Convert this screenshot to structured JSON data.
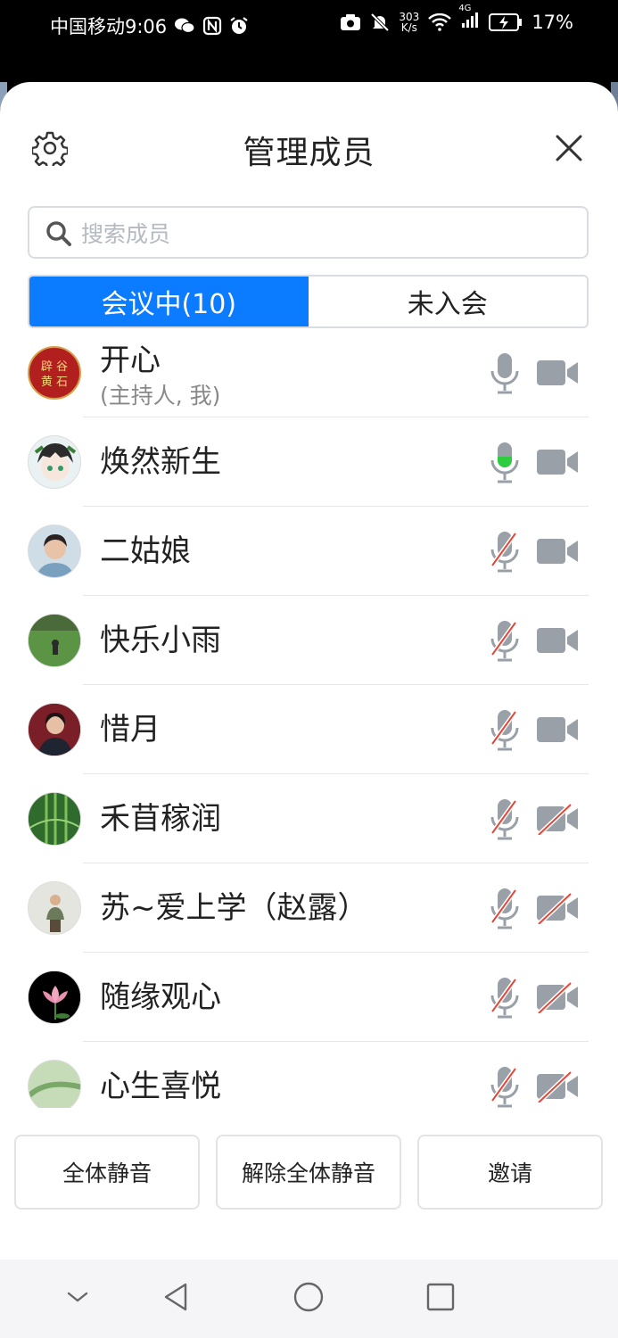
{
  "status_bar": {
    "carrier_time": "中国移动9:06",
    "net_speed_top": "303",
    "net_speed_bottom": "K/s",
    "signal_tag": "4G",
    "battery": "17%"
  },
  "panel": {
    "title": "管理成员",
    "search_placeholder": "搜索成员",
    "tabs": [
      {
        "label": "会议中(10)",
        "active": true
      },
      {
        "label": "未入会",
        "active": false
      }
    ]
  },
  "members": [
    {
      "name": "开心",
      "sub": "(主持人, 我)",
      "avatar_text": "辟 谷\n黄 石",
      "mic": "on",
      "camera": "on"
    },
    {
      "name": "焕然新生",
      "sub": "",
      "mic": "speaking",
      "camera": "on"
    },
    {
      "name": "二姑娘",
      "sub": "",
      "mic": "muted",
      "camera": "on"
    },
    {
      "name": "快乐小雨",
      "sub": "",
      "mic": "muted",
      "camera": "on"
    },
    {
      "name": "惜月",
      "sub": "",
      "mic": "muted",
      "camera": "on"
    },
    {
      "name": "禾苜稼润",
      "sub": "",
      "mic": "muted",
      "camera": "off"
    },
    {
      "name": "苏~爱上学（赵露）",
      "sub": "",
      "mic": "muted",
      "camera": "off"
    },
    {
      "name": "随缘观心",
      "sub": "",
      "mic": "muted",
      "camera": "off"
    },
    {
      "name": "心生喜悦",
      "sub": "",
      "mic": "muted",
      "camera": "off"
    }
  ],
  "actions": {
    "mute_all": "全体静音",
    "unmute_all": "解除全体静音",
    "invite": "邀请"
  },
  "colors": {
    "accent": "#0b7bff",
    "icon_gray": "#9aa0a8",
    "muted_slash": "#e0483a",
    "speaking": "#2ecc40"
  }
}
